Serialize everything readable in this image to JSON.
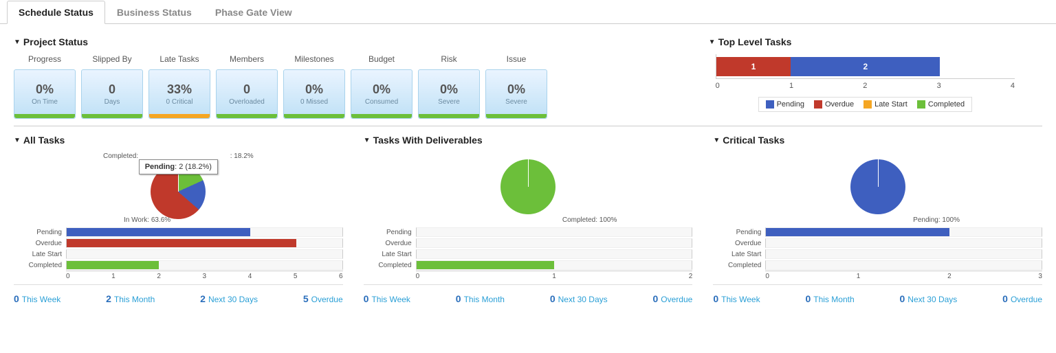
{
  "tabs": [
    "Schedule Status",
    "Business Status",
    "Phase Gate View"
  ],
  "panels": {
    "project_status": "Project Status",
    "top_level_tasks": "Top Level Tasks",
    "all_tasks": "All Tasks",
    "tasks_deliverables": "Tasks With Deliverables",
    "critical_tasks": "Critical Tasks"
  },
  "status_cards": [
    {
      "label": "Progress",
      "value": "0%",
      "sub": "On Time",
      "bar": "green"
    },
    {
      "label": "Slipped By",
      "value": "0",
      "sub": "Days",
      "bar": "green"
    },
    {
      "label": "Late Tasks",
      "value": "33%",
      "sub": "0 Critical",
      "bar": "orange"
    },
    {
      "label": "Members",
      "value": "0",
      "sub": "Overloaded",
      "bar": "green"
    },
    {
      "label": "Milestones",
      "value": "0%",
      "sub": "0 Missed",
      "bar": "green"
    },
    {
      "label": "Budget",
      "value": "0%",
      "sub": "Consumed",
      "bar": "green"
    },
    {
      "label": "Risk",
      "value": "0%",
      "sub": "Severe",
      "bar": "green"
    },
    {
      "label": "Issue",
      "value": "0%",
      "sub": "Severe",
      "bar": "green"
    }
  ],
  "top_level_tasks_legend": [
    "Pending",
    "Overdue",
    "Late Start",
    "Completed"
  ],
  "chart_data": {
    "top_level_tasks": {
      "type": "bar",
      "orientation": "horizontal-stacked",
      "series": [
        {
          "name": "Overdue",
          "value": 1,
          "color": "#c0392b"
        },
        {
          "name": "Pending",
          "value": 2,
          "color": "#3e5fbf"
        }
      ],
      "axis": {
        "min": 0,
        "max": 4,
        "ticks": [
          0,
          1,
          2,
          3,
          4
        ]
      }
    },
    "all_tasks": {
      "pie": {
        "type": "pie",
        "slices": [
          {
            "name": "In Work",
            "value": 63.6,
            "color": "#c0392b"
          },
          {
            "name": "Pending",
            "value": 18.2,
            "color": "#3e5fbf"
          },
          {
            "name": "Completed",
            "value": 18.2,
            "color": "#6cbf3a"
          }
        ],
        "labels": {
          "completed": "Completed:",
          "inwork": "In Work: 63.6%",
          "pending_suffix": ": 18.2%"
        },
        "tooltip": {
          "name": "Pending",
          "detail": ": 2 (18.2%)"
        }
      },
      "bars": {
        "type": "bar",
        "categories": [
          "Pending",
          "Overdue",
          "Late Start",
          "Completed"
        ],
        "values": [
          4,
          5,
          0,
          2
        ],
        "colors": [
          "#3e5fbf",
          "#c0392b",
          "#f5a623",
          "#6cbf3a"
        ],
        "xmax": 6,
        "ticks": [
          0,
          1,
          2,
          3,
          4,
          5,
          6
        ]
      },
      "summary": [
        {
          "n": "0",
          "l": "This Week"
        },
        {
          "n": "2",
          "l": "This Month"
        },
        {
          "n": "2",
          "l": "Next 30 Days"
        },
        {
          "n": "5",
          "l": "Overdue"
        }
      ]
    },
    "tasks_deliverables": {
      "pie": {
        "type": "pie",
        "slices": [
          {
            "name": "Completed",
            "value": 100,
            "color": "#6cbf3a"
          }
        ],
        "label": "Completed: 100%"
      },
      "bars": {
        "type": "bar",
        "categories": [
          "Pending",
          "Overdue",
          "Late Start",
          "Completed"
        ],
        "values": [
          0,
          0,
          0,
          1
        ],
        "colors": [
          "#3e5fbf",
          "#c0392b",
          "#f5a623",
          "#6cbf3a"
        ],
        "xmax": 2,
        "ticks": [
          0,
          1,
          2
        ]
      },
      "summary": [
        {
          "n": "0",
          "l": "This Week"
        },
        {
          "n": "0",
          "l": "This Month"
        },
        {
          "n": "0",
          "l": "Next 30 Days"
        },
        {
          "n": "0",
          "l": "Overdue"
        }
      ]
    },
    "critical_tasks": {
      "pie": {
        "type": "pie",
        "slices": [
          {
            "name": "Pending",
            "value": 100,
            "color": "#3e5fbf"
          }
        ],
        "label": "Pending: 100%"
      },
      "bars": {
        "type": "bar",
        "categories": [
          "Pending",
          "Overdue",
          "Late Start",
          "Completed"
        ],
        "values": [
          2,
          0,
          0,
          0
        ],
        "colors": [
          "#3e5fbf",
          "#c0392b",
          "#f5a623",
          "#6cbf3a"
        ],
        "xmax": 3,
        "ticks": [
          0,
          1,
          2,
          3
        ]
      },
      "summary": [
        {
          "n": "0",
          "l": "This Week"
        },
        {
          "n": "0",
          "l": "This Month"
        },
        {
          "n": "0",
          "l": "Next 30 Days"
        },
        {
          "n": "0",
          "l": "Overdue"
        }
      ]
    }
  }
}
